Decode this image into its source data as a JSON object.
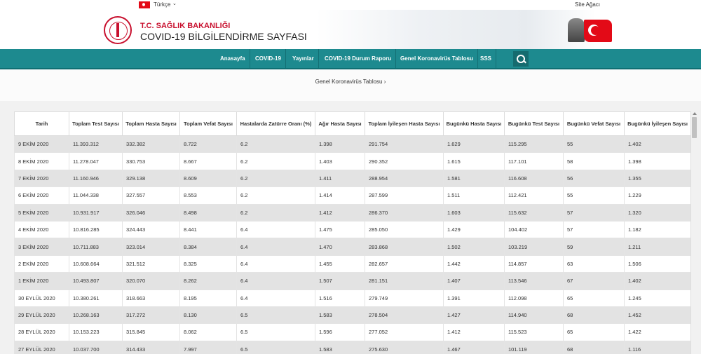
{
  "topbar": {
    "language": "Türkçe",
    "sitemap": "Site Ağacı"
  },
  "header": {
    "ministry": "T.C. SAĞLIK BAKANLIĞI",
    "title": "COVID-19 BİLGİLENDİRME SAYFASI"
  },
  "nav": [
    {
      "label": "Anasayfa"
    },
    {
      "label": "COVID-19"
    },
    {
      "label": "Yayınlar"
    },
    {
      "label": "COVID-19 Durum Raporu"
    },
    {
      "label": "Genel Koronavirüs Tablosu"
    },
    {
      "label": "SSS"
    }
  ],
  "breadcrumb": "Genel Koronavirüs Tablosu ›",
  "table": {
    "columns": [
      "Tarih",
      "Toplam Test Sayısı",
      "Toplam Hasta Sayısı",
      "Toplam Vefat Sayısı",
      "Hastalarda Zatürre Oranı (%)",
      "Ağır Hasta Sayısı",
      "Toplam İyileşen Hasta Sayısı",
      "Bugünkü Hasta Sayısı",
      "Bugünkü Test Sayısı",
      "Bugünkü Vefat Sayısı",
      "Bugünkü İyileşen Sayısı"
    ],
    "rows": [
      [
        "9 EKİM 2020",
        "11.393.312",
        "332.382",
        "8.722",
        "6.2",
        "1.398",
        "291.754",
        "1.629",
        "115.295",
        "55",
        "1.402"
      ],
      [
        "8 EKİM 2020",
        "11.278.047",
        "330.753",
        "8.667",
        "6.2",
        "1.403",
        "290.352",
        "1.615",
        "117.101",
        "58",
        "1.398"
      ],
      [
        "7 EKİM 2020",
        "11.160.946",
        "329.138",
        "8.609",
        "6.2",
        "1.411",
        "288.954",
        "1.581",
        "116.608",
        "56",
        "1.355"
      ],
      [
        "6 EKİM 2020",
        "11.044.338",
        "327.557",
        "8.553",
        "6.2",
        "1.414",
        "287.599",
        "1.511",
        "112.421",
        "55",
        "1.229"
      ],
      [
        "5 EKİM 2020",
        "10.931.917",
        "326.046",
        "8.498",
        "6.2",
        "1.412",
        "286.370",
        "1.603",
        "115.632",
        "57",
        "1.320"
      ],
      [
        "4 EKİM 2020",
        "10.816.285",
        "324.443",
        "8.441",
        "6.4",
        "1.475",
        "285.050",
        "1.429",
        "104.402",
        "57",
        "1.182"
      ],
      [
        "3 EKİM 2020",
        "10.711.883",
        "323.014",
        "8.384",
        "6.4",
        "1.470",
        "283.868",
        "1.502",
        "103.219",
        "59",
        "1.211"
      ],
      [
        "2 EKİM 2020",
        "10.608.664",
        "321.512",
        "8.325",
        "6.4",
        "1.455",
        "282.657",
        "1.442",
        "114.857",
        "63",
        "1.506"
      ],
      [
        "1 EKİM 2020",
        "10.493.807",
        "320.070",
        "8.262",
        "6.4",
        "1.507",
        "281.151",
        "1.407",
        "113.546",
        "67",
        "1.402"
      ],
      [
        "30 EYLÜL 2020",
        "10.380.261",
        "318.663",
        "8.195",
        "6.4",
        "1.516",
        "279.749",
        "1.391",
        "112.098",
        "65",
        "1.245"
      ],
      [
        "29 EYLÜL 2020",
        "10.268.163",
        "317.272",
        "8.130",
        "6.5",
        "1.583",
        "278.504",
        "1.427",
        "114.940",
        "68",
        "1.452"
      ],
      [
        "28 EYLÜL 2020",
        "10.153.223",
        "315.845",
        "8.062",
        "6.5",
        "1.596",
        "277.052",
        "1.412",
        "115.523",
        "65",
        "1.422"
      ],
      [
        "27 EYLÜL 2020",
        "10.037.700",
        "314.433",
        "7.997",
        "6.5",
        "1.583",
        "275.630",
        "1.467",
        "101.119",
        "68",
        "1.116"
      ]
    ]
  }
}
